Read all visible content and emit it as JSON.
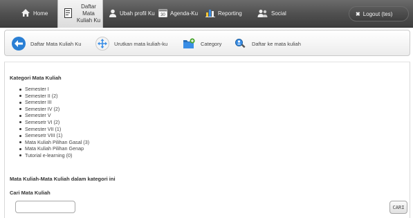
{
  "nav": {
    "home": "Home",
    "daftar_line1": "Daftar Mata",
    "daftar_line2": "Kuliah Ku",
    "ubah_profil": "Ubah profil Ku",
    "agenda": "Agenda-Ku",
    "reporting": "Reporting",
    "social": "Social",
    "logout": "Logout (tes)"
  },
  "toolbar": {
    "daftar": "Daftar Mata Kuliah Ku",
    "urutkan": "Urutkan mata kuliah-ku",
    "category": "Category",
    "daftar_ke": "Daftar ke mata kuliah"
  },
  "content": {
    "kategori_heading": "Kategori Mata Kuliah",
    "semesters": [
      "Semester I",
      "Semester II (2)",
      "Semester III",
      "Semester IV (2)",
      "Semester V",
      "Semesetr VI (2)",
      "Semester VII (1)",
      "Semesetr VIII (1)",
      "Mata Kuliah Pilihan Gasal (3)",
      "Mata Kuliah Pilihan Genap",
      "Tutorial e-learning (0)"
    ],
    "matakuliah_heading": "Mata Kuliah-Mata Kuliah dalam kategori ini",
    "cari_heading": "Cari Mata Kuliah",
    "search_value": "",
    "cari_button": "CARI"
  },
  "colors": {
    "nav_bg": "#4e4e4e",
    "accent_blue": "#2a7fd4",
    "accent_green": "#4aa52e"
  }
}
